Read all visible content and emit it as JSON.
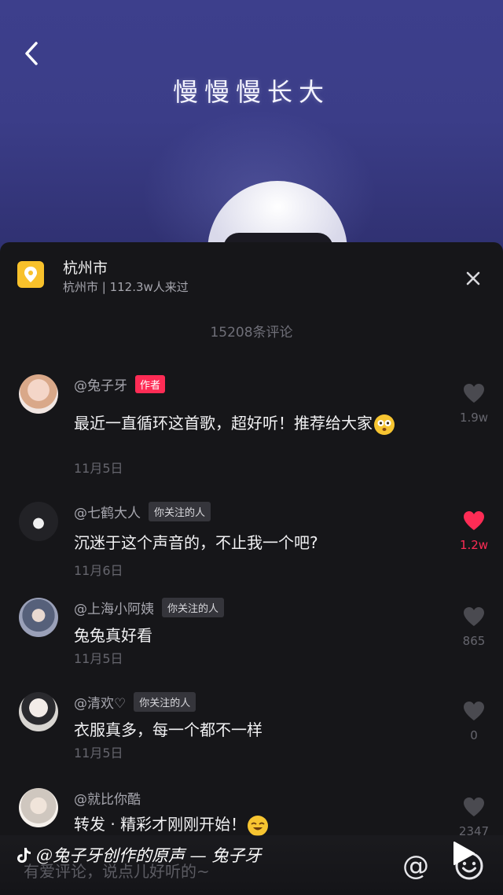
{
  "video": {
    "lyric": "慢慢慢长大"
  },
  "location": {
    "title": "杭州市",
    "subtitle": "杭州市 | 112.3w人来过"
  },
  "comments_count": "15208条评论",
  "comments": [
    {
      "user": "@兔子牙",
      "badge": "作者",
      "text": "最近一直循环这首歌，超好听！推荐给大家",
      "date": "11月5日",
      "likes": "1.9w",
      "liked": false
    },
    {
      "user": "@七鹤大人",
      "badge": "你关注的人",
      "text": "沉迷于这个声音的，不止我一个吧?",
      "date": "11月6日",
      "likes": "1.2w",
      "liked": true
    },
    {
      "user": "@上海小阿姨",
      "badge": "你关注的人",
      "text": "兔兔真好看",
      "date": "11月5日",
      "likes": "865",
      "liked": false
    },
    {
      "user": "@清欢♡",
      "badge": "你关注的人",
      "text": "衣服真多，每一个都不一样",
      "date": "11月5日",
      "likes": "0",
      "liked": false
    },
    {
      "user": "@就比你酷",
      "badge": "",
      "text": "转发 · 精彩才刚刚开始！",
      "date": "",
      "likes": "2347",
      "liked": false
    }
  ],
  "bottom": {
    "input_placeholder": "有爱评论，说点儿好听的~",
    "music": "@兔子牙创作的原声 — 兔子牙",
    "at_symbol": "@"
  },
  "colors": {
    "accent": "#fe2c55",
    "location_icon": "#f8c12b",
    "video_bg": "#3b3d88"
  }
}
